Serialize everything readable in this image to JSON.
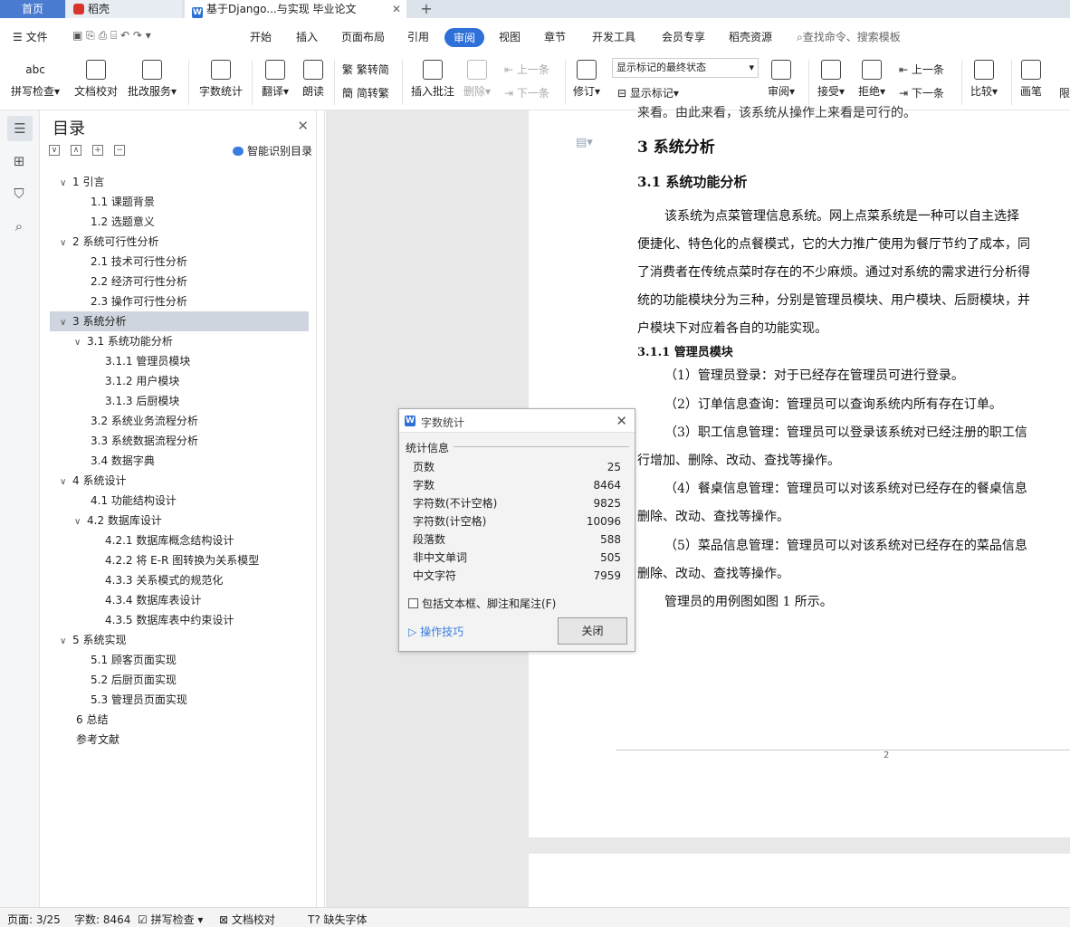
{
  "tabs": {
    "home": "首页",
    "daoke": "稻壳",
    "document": "基于Django...与实现 毕业论文",
    "add": "+"
  },
  "menu": {
    "file": "文件",
    "items": [
      "开始",
      "插入",
      "页面布局",
      "引用",
      "审阅",
      "视图",
      "章节",
      "开发工具",
      "会员专享",
      "稻壳资源"
    ],
    "active": "审阅",
    "search": "查找命令、搜索模板"
  },
  "ribbon": {
    "spellcheck": "拼写检查",
    "doc_proof": "文档校对",
    "batch": "批改服务",
    "wordcount": "字数统计",
    "translate": "翻译",
    "read": "朗读",
    "trad": "繁转简",
    "simp": "简转繁",
    "insert_comment": "插入批注",
    "delete": "删除",
    "prev": "上一条",
    "next": "下一条",
    "revise": "修订",
    "mark_state": "显示标记的最终状态",
    "show_marks": "显示标记",
    "review": "审阅",
    "accept": "接受",
    "reject": "拒绝",
    "prev2": "上一条",
    "next2": "下一条",
    "compare": "比较",
    "pen": "画笔",
    "limit": "限"
  },
  "toc": {
    "title": "目录",
    "smart": "智能识别目录",
    "items": [
      {
        "text": "1  引言",
        "arrow": "∨"
      },
      {
        "text": "1.1 课题背景",
        "arrow": ""
      },
      {
        "text": "1.2 选题意义",
        "arrow": ""
      },
      {
        "text": "2  系统可行性分析",
        "arrow": "∨"
      },
      {
        "text": "2.1  技术可行性分析",
        "arrow": ""
      },
      {
        "text": "2.2  经济可行性分析",
        "arrow": ""
      },
      {
        "text": "2.3  操作可行性分析",
        "arrow": ""
      },
      {
        "text": "3 系统分析",
        "arrow": "∨"
      },
      {
        "text": "3.1  系统功能分析",
        "arrow": "∨"
      },
      {
        "text": "3.1.1  管理员模块",
        "arrow": ""
      },
      {
        "text": "3.1.2  用户模块",
        "arrow": ""
      },
      {
        "text": "3.1.3  后厨模块",
        "arrow": ""
      },
      {
        "text": "3.2  系统业务流程分析",
        "arrow": ""
      },
      {
        "text": "3.3  系统数据流程分析",
        "arrow": ""
      },
      {
        "text": "3.4  数据字典",
        "arrow": ""
      },
      {
        "text": "4  系统设计",
        "arrow": "∨"
      },
      {
        "text": "4.1  功能结构设计",
        "arrow": ""
      },
      {
        "text": "4.2  数据库设计",
        "arrow": "∨"
      },
      {
        "text": "4.2.1  数据库概念结构设计",
        "arrow": ""
      },
      {
        "text": "4.2.2  将 E-R 图转换为关系模型",
        "arrow": ""
      },
      {
        "text": "4.3.3  关系模式的规范化",
        "arrow": ""
      },
      {
        "text": "4.3.4  数据库表设计",
        "arrow": ""
      },
      {
        "text": "4.3.5  数据库表中约束设计",
        "arrow": ""
      },
      {
        "text": "5  系统实现",
        "arrow": "∨"
      },
      {
        "text": "5.1  顾客页面实现",
        "arrow": ""
      },
      {
        "text": "5.2  后厨页面实现",
        "arrow": ""
      },
      {
        "text": "5.3  管理员页面实现",
        "arrow": ""
      },
      {
        "text": "6  总结",
        "arrow": ""
      },
      {
        "text": "参考文献",
        "arrow": ""
      }
    ]
  },
  "doc": {
    "top_cut": "来看。由此来看，该系统从操作上来看是可行的。",
    "h_section": "3 系统分析",
    "h_sub": "3.1  系统功能分析",
    "para_lines": [
      "该系统为点菜管理信息系统。网上点菜系统是一种可以自主选择",
      "便捷化、特色化的点餐模式，它的大力推广使用为餐厅节约了成本，同",
      "了消费者在传统点菜时存在的不少麻烦。通过对系统的需求进行分析得",
      "统的功能模块分为三种，分别是管理员模块、用户模块、后厨模块，并",
      "户模块下对应着各自的功能实现。"
    ],
    "h_subsub": "3.1.1  管理员模块",
    "items": [
      "（1）管理员登录：对于已经存在管理员可进行登录。",
      "（2）订单信息查询：管理员可以查询系统内所有存在订单。",
      "（3）职工信息管理：管理员可以登录该系统对已经注册的职工信",
      "行增加、删除、改动、查找等操作。",
      "（4）餐桌信息管理：管理员可以对该系统对已经存在的餐桌信息",
      "删除、改动、查找等操作。",
      "（5）菜品信息管理：管理员可以对该系统对已经存在的菜品信息",
      "删除、改动、查找等操作。",
      "管理员的用例图如图 1 所示。"
    ],
    "page_number": "2"
  },
  "dialog": {
    "title": "字数统计",
    "section": "统计信息",
    "rows": [
      {
        "label": "页数",
        "value": "25"
      },
      {
        "label": "字数",
        "value": "8464"
      },
      {
        "label": "字符数(不计空格)",
        "value": "9825"
      },
      {
        "label": "字符数(计空格)",
        "value": "10096"
      },
      {
        "label": "段落数",
        "value": "588"
      },
      {
        "label": "非中文单词",
        "value": "505"
      },
      {
        "label": "中文字符",
        "value": "7959"
      }
    ],
    "checkbox": "包括文本框、脚注和尾注(F)",
    "tips": "操作技巧",
    "close": "关闭"
  },
  "status": {
    "page": "页面: 3/25",
    "words": "字数: 8464",
    "spell": "拼写检查",
    "proof": "文档校对",
    "missing_font": "缺失字体"
  },
  "colors": {
    "accent": "#2e6fd8",
    "home_tab": "#4a7bd0",
    "selection": "#cfd5de"
  }
}
